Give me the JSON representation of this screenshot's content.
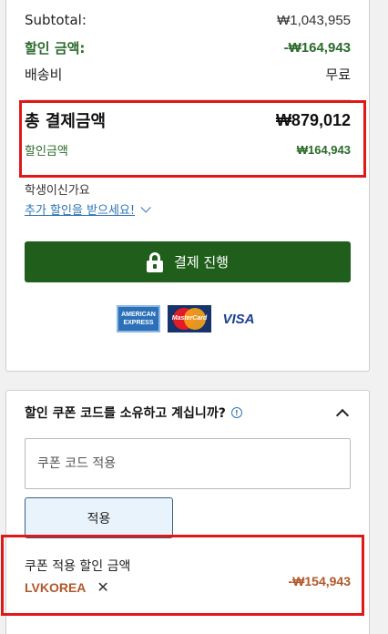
{
  "summary": {
    "subtotal_label": "Subtotal:",
    "subtotal_value": "₩1,043,955",
    "discount_label": "할인 금액:",
    "discount_value": "-₩164,943",
    "shipping_label": "배송비",
    "shipping_value": "무료",
    "total_label": "총 결제금액",
    "total_value": "₩879,012",
    "total_discount_label": "할인금액",
    "total_discount_value": "₩164,943",
    "student_label": "학생이신가요",
    "student_link": "추가 할인을 받으세요!",
    "pay_button": "결제 진행",
    "card_logos": {
      "amex": [
        "AMERICAN",
        "EXPRESS"
      ],
      "mastercard": "MasterCard",
      "visa": "VISA"
    }
  },
  "coupon": {
    "title": "할인 쿠폰 코드를 소유하고 계십니까?",
    "input_placeholder": "쿠폰 코드 적용",
    "apply_button": "적용",
    "applied_label": "쿠폰 적용 할인 금액",
    "code": "LVKOREA",
    "amount": "-₩154,943"
  },
  "colors": {
    "discount_green": "#2a6b2a",
    "pay_button_bg": "#1f5f1b",
    "highlight_red": "#e01818",
    "coupon_orange": "#b2572a",
    "link_blue": "#2f74b5"
  }
}
